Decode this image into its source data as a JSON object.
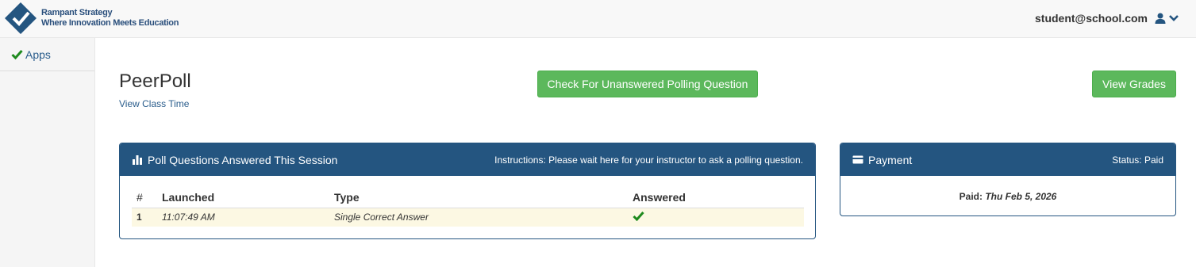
{
  "header": {
    "brand_line1": "Rampant Strategy",
    "brand_line2": "Where Innovation Meets Education",
    "user_email": "student@school.com",
    "user_icon": "user-icon",
    "caret_icon": "chevron-down-icon"
  },
  "sidebar": {
    "items": [
      {
        "label": "Apps",
        "icon": "check-icon"
      }
    ]
  },
  "main": {
    "title": "PeerPoll",
    "class_time_link": "View Class Time",
    "check_button": "Check For Unanswered Polling Question",
    "grades_button": "View Grades"
  },
  "poll_panel": {
    "title": "Poll Questions Answered This Session",
    "instructions": "Instructions: Please wait here for your instructor to ask a polling question.",
    "columns": [
      "#",
      "Launched",
      "Type",
      "Answered"
    ],
    "rows": [
      {
        "num": "1",
        "launched": "11:07:49 AM",
        "type": "Single Correct Answer",
        "answered_icon": "check-icon"
      }
    ]
  },
  "payment_panel": {
    "title": "Payment",
    "status": "Status: Paid",
    "paid_label": "Paid:",
    "paid_date": "Thu Feb 5, 2026"
  },
  "colors": {
    "brand_blue": "#245580",
    "success_green": "#5cb85c",
    "check_green": "#1e8a1e",
    "row_highlight": "#fcf8e3"
  }
}
